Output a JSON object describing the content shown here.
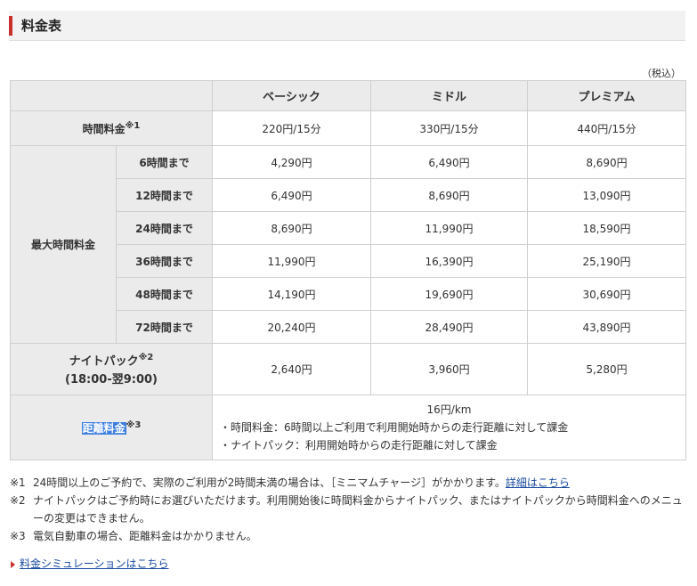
{
  "section": {
    "title": "料金表"
  },
  "tax_note": "（税込）",
  "plans": [
    "ベーシック",
    "ミドル",
    "プレミアム"
  ],
  "hourly": {
    "label": "時間料金",
    "mark": "※1",
    "values": [
      "220円/15分",
      "330円/15分",
      "440円/15分"
    ]
  },
  "max": {
    "label": "最大時間料金",
    "rows": [
      {
        "label": "6時間まで",
        "values": [
          "4,290円",
          "6,490円",
          "8,690円"
        ]
      },
      {
        "label": "12時間まで",
        "values": [
          "6,490円",
          "8,690円",
          "13,090円"
        ]
      },
      {
        "label": "24時間まで",
        "values": [
          "8,690円",
          "11,990円",
          "18,590円"
        ]
      },
      {
        "label": "36時間まで",
        "values": [
          "11,990円",
          "16,390円",
          "25,190円"
        ]
      },
      {
        "label": "48時間まで",
        "values": [
          "14,190円",
          "19,690円",
          "30,690円"
        ]
      },
      {
        "label": "72時間まで",
        "values": [
          "20,240円",
          "28,490円",
          "43,890円"
        ]
      }
    ]
  },
  "night": {
    "label1": "ナイトパック",
    "mark": "※2",
    "label2": "(18:00-翌9:00)",
    "values": [
      "2,640円",
      "3,960円",
      "5,280円"
    ]
  },
  "distance": {
    "label": "距離料金",
    "mark": "※3",
    "rate": "16円/km",
    "line1": "・時間料金：6時間以上ご利用で利用開始時からの走行距離に対して課金",
    "line2": "・ナイトパック：利用開始時からの走行距離に対して課金"
  },
  "notes": [
    {
      "mark": "※1",
      "text": "24時間以上のご予約で、実際のご利用が2時間未満の場合は、［ミニマムチャージ］がかかります。",
      "link": "詳細はこちら"
    },
    {
      "mark": "※2",
      "text": "ナイトパックはご予約時にお選びいただけます。利用開始後に時間料金からナイトパック、またはナイトパックから時間料金へのメニューの変更はできません。"
    },
    {
      "mark": "※3",
      "text": "電気自動車の場合、距離料金はかかりません。"
    }
  ],
  "simulation_link": "料金シミュレーションはこちら"
}
